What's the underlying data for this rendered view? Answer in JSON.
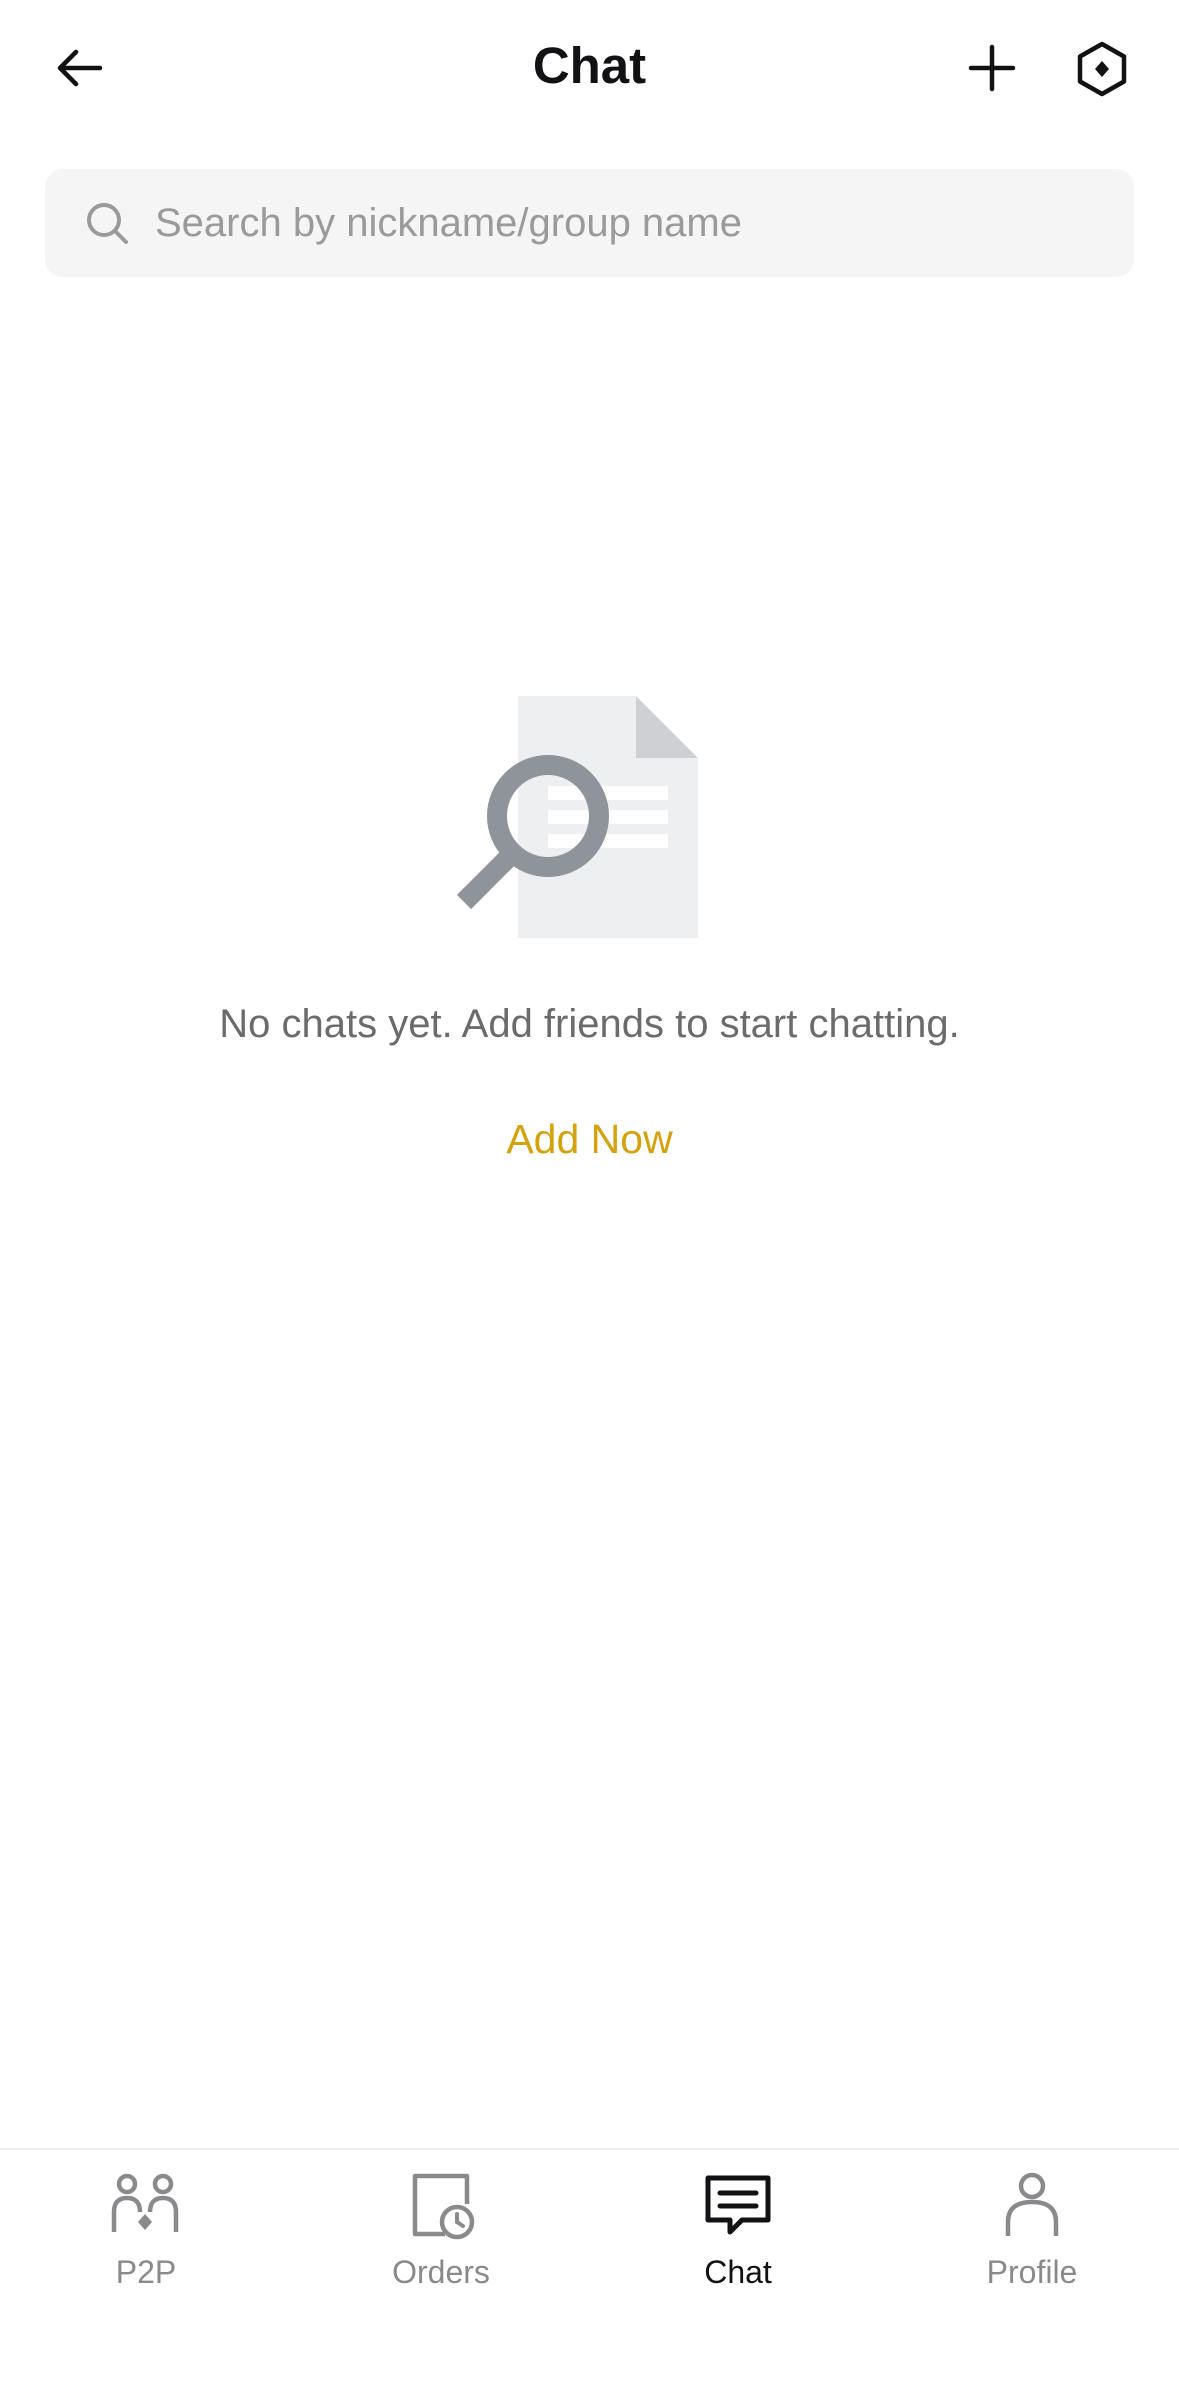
{
  "header": {
    "title": "Chat",
    "back_icon": "arrow-left-icon",
    "add_icon": "plus-icon",
    "settings_icon": "hexagon-settings-icon"
  },
  "search": {
    "placeholder": "Search by nickname/group name",
    "value": "",
    "icon": "search-icon"
  },
  "empty_state": {
    "illustration": "document-magnifier-icon",
    "message": "No chats yet. Add friends to start chatting.",
    "action_label": "Add Now"
  },
  "bottom_nav": {
    "items": [
      {
        "label": "P2P",
        "icon": "p2p-icon",
        "active": false
      },
      {
        "label": "Orders",
        "icon": "orders-icon",
        "active": false
      },
      {
        "label": "Chat",
        "icon": "chat-icon",
        "active": true
      },
      {
        "label": "Profile",
        "icon": "profile-icon",
        "active": false
      }
    ]
  },
  "colors": {
    "accent": "#d4a20c",
    "text_primary": "#121214",
    "text_secondary": "#6b6b6e",
    "nav_inactive": "#8a8a8d",
    "search_bg": "#f5f5f5"
  }
}
